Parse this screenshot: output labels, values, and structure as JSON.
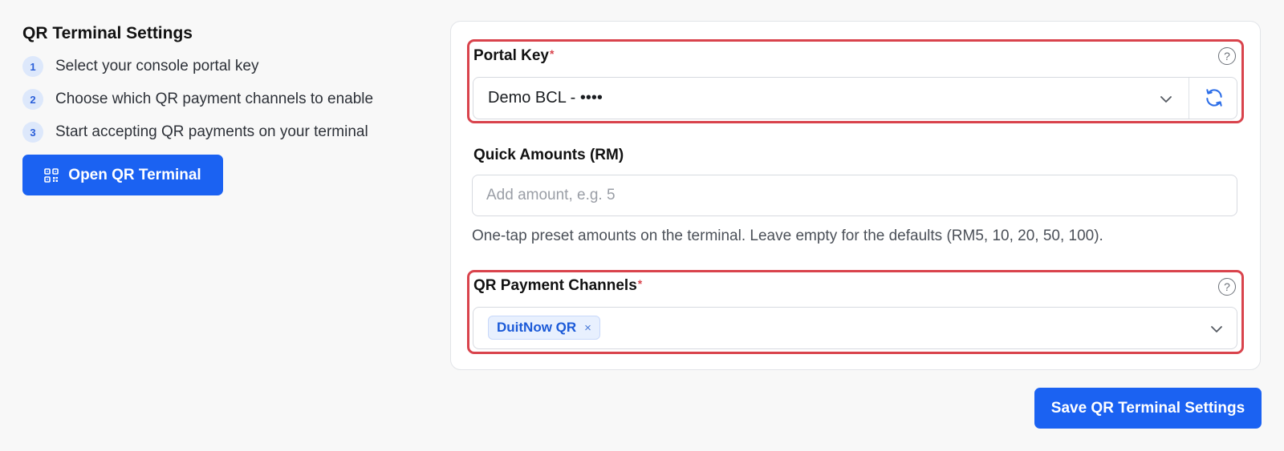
{
  "left": {
    "title": "QR Terminal Settings",
    "steps": [
      {
        "num": "1",
        "text": "Select your console portal key"
      },
      {
        "num": "2",
        "text": "Choose which QR payment channels to enable"
      },
      {
        "num": "3",
        "text": "Start accepting QR payments on your terminal"
      }
    ],
    "open_button": {
      "label": "Open QR Terminal",
      "icon": "qr-code-icon"
    }
  },
  "form": {
    "portal_key": {
      "label": "Portal Key",
      "required_mark": "*",
      "help_icon": "?",
      "value": "Demo BCL - ••••",
      "refresh_icon": "refresh-icon"
    },
    "quick_amounts": {
      "label": "Quick Amounts (RM)",
      "placeholder": "Add amount, e.g. 5",
      "hint": "One-tap preset amounts on the terminal. Leave empty for the defaults (RM5, 10, 20, 50, 100)."
    },
    "channels": {
      "label": "QR Payment Channels",
      "required_mark": "*",
      "help_icon": "?",
      "selected": [
        {
          "label": "DuitNow QR",
          "remove": "×"
        }
      ]
    }
  },
  "save_button": {
    "label": "Save QR Terminal Settings"
  },
  "colors": {
    "primary": "#1b62f2",
    "highlight": "#d9434c",
    "step_badge_bg": "#dde8fb",
    "tag_bg": "#e8f0fe"
  }
}
